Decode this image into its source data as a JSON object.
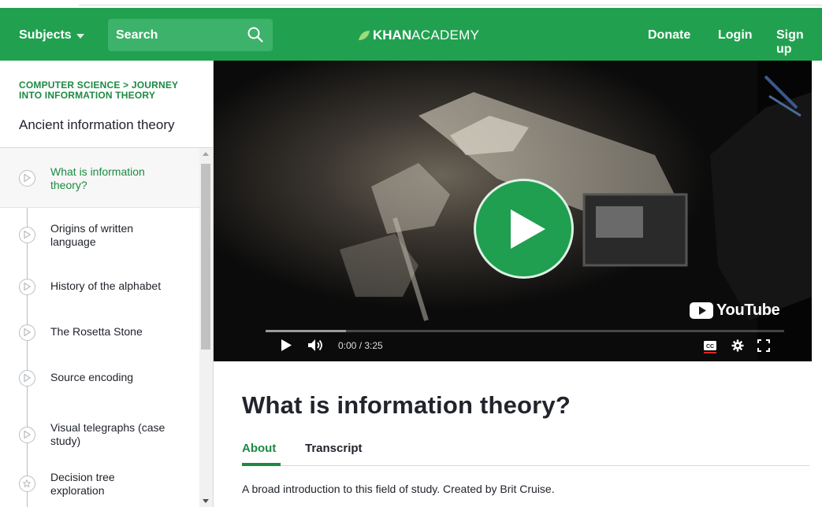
{
  "header": {
    "subjects_label": "Subjects",
    "search_placeholder": "Search",
    "logo_bold": "KHAN",
    "logo_light": "ACADEMY",
    "donate_label": "Donate",
    "login_label": "Login",
    "signup_label": "Sign up"
  },
  "sidebar": {
    "breadcrumb_line1": "COMPUTER SCIENCE > JOURNEY",
    "breadcrumb_line2": "INTO INFORMATION THEORY",
    "unit_title": "Ancient information theory",
    "lessons": [
      {
        "line1": "What is information",
        "line2": "theory?",
        "icon": "play-icon",
        "active": true
      },
      {
        "line1": "Origins of written",
        "line2": "language",
        "icon": "play-icon"
      },
      {
        "line1": "History of the alphabet",
        "line2": "",
        "icon": "play-icon"
      },
      {
        "line1": "The Rosetta Stone",
        "line2": "",
        "icon": "play-icon"
      },
      {
        "line1": "Source encoding",
        "line2": "",
        "icon": "play-icon"
      },
      {
        "line1": "Visual telegraphs (case",
        "line2": "study)",
        "icon": "play-icon"
      },
      {
        "line1": "Decision tree",
        "line2": "exploration",
        "icon": "star-icon"
      }
    ]
  },
  "video": {
    "platform_label": "YouTube",
    "time_current": "0:00",
    "time_total": "3:25",
    "progress": 0.155
  },
  "content": {
    "title": "What is information theory?",
    "tabs": [
      {
        "label": "About",
        "active": true
      },
      {
        "label": "Transcript"
      }
    ],
    "description": "A broad introduction to this field of study. Created by Brit Cruise."
  },
  "colors": {
    "brand_green": "#21a150",
    "text_green": "#1c8a43",
    "text_dark": "#21242c"
  }
}
